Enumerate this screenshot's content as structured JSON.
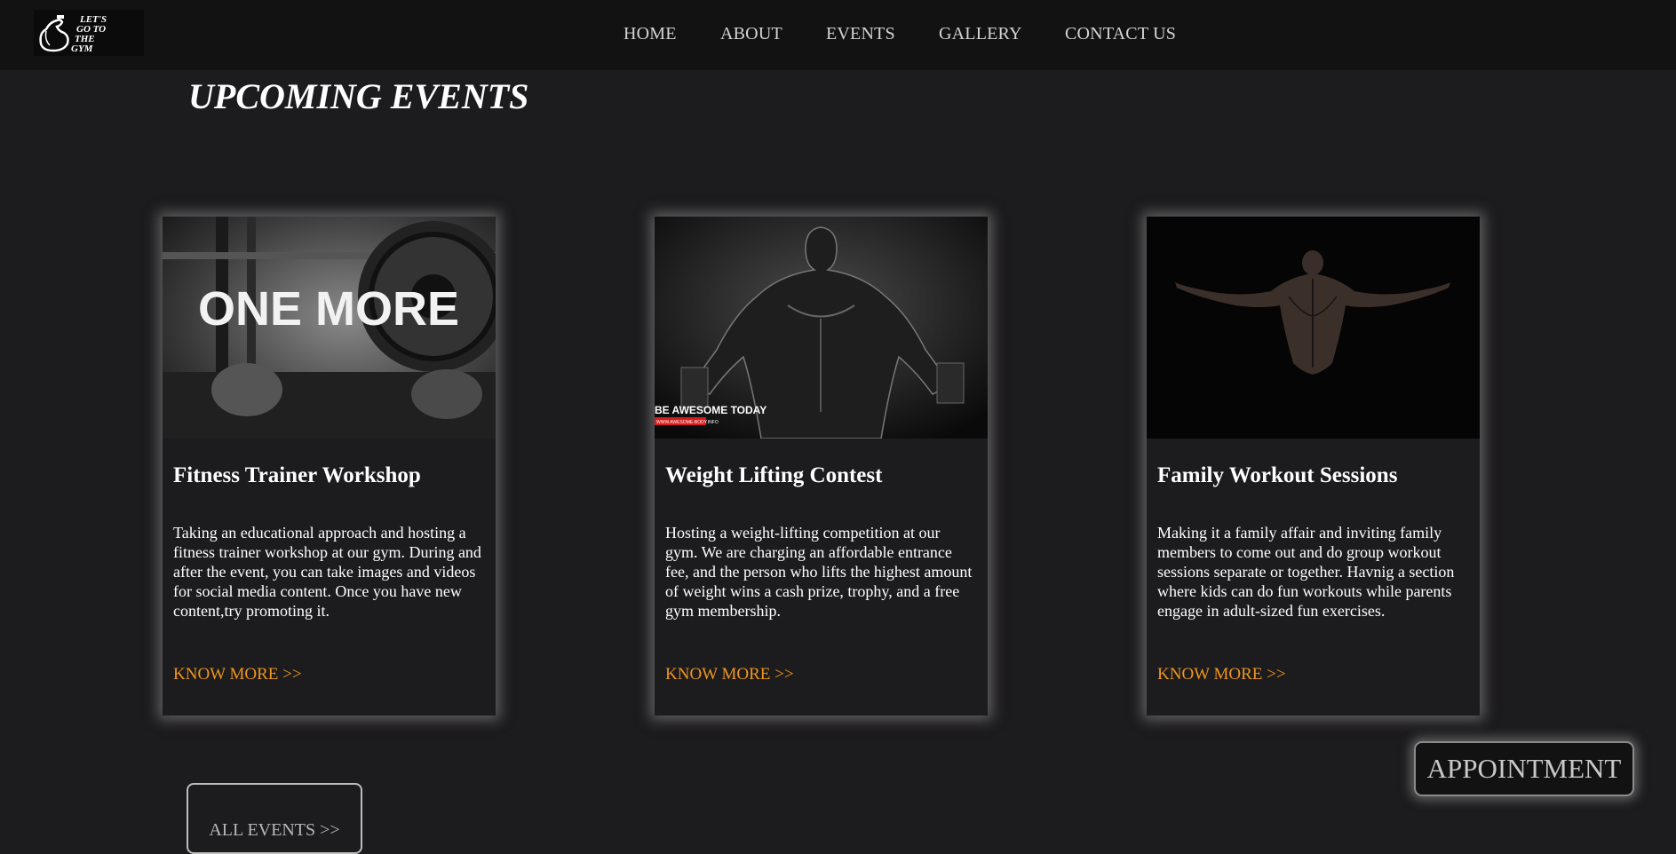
{
  "logo": {
    "text_lines": [
      "LET'S",
      "GO TO",
      "THE",
      "GYM"
    ],
    "icon": "flexed-arm-icon"
  },
  "nav": {
    "items": [
      {
        "label": "HOME"
      },
      {
        "label": "ABOUT"
      },
      {
        "label": "EVENTS"
      },
      {
        "label": "GALLERY"
      },
      {
        "label": "CONTACT US"
      }
    ]
  },
  "main": {
    "title": "UPCOMING EVENTS",
    "events": [
      {
        "title": "Fitness Trainer Workshop",
        "description": "Taking an educational approach and hosting a fitness trainer workshop at our gym. During and after the event, you can take images and videos for social media content. Once you have new content,try promoting it.",
        "link": "KNOW MORE >>",
        "image_text": "ONE MORE"
      },
      {
        "title": "Weight Lifting Contest",
        "description": "Hosting a weight-lifting competition at our gym. We are charging an affordable entrance fee, and the person who lifts the highest amount of weight wins a cash prize, trophy, and a free gym membership.",
        "link": "KNOW MORE >>",
        "image_text": "BE AWESOME TODAY",
        "image_subtext": "WWW.AWESOME-BODY.INFO"
      },
      {
        "title": "Family Workout Sessions",
        "description": "Making it a family affair and inviting family members to come out and do group workout sessions separate or together. Havnig a section where kids can do fun workouts while parents engage in adult-sized fun exercises.",
        "link": "KNOW MORE >>"
      }
    ],
    "all_events_label": "ALL EVENTS >>"
  },
  "appointment_label": "APPOINTMENT",
  "colors": {
    "background": "#1c1b1d",
    "navbar": "#121212",
    "accent": "#f0961e",
    "text": "#ffffff"
  }
}
